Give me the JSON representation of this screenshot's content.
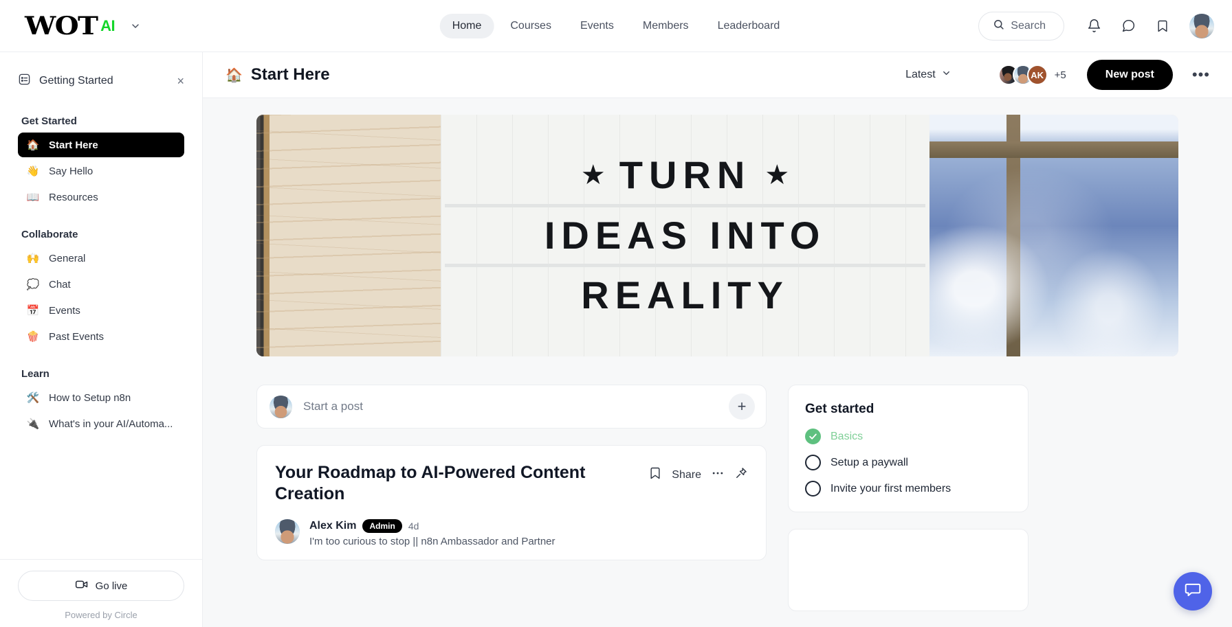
{
  "topbar": {
    "logo_primary": "WOT",
    "logo_accent": "AI",
    "logo_caret_icon": "chevron-down-icon",
    "nav": [
      {
        "label": "Home",
        "active": true
      },
      {
        "label": "Courses",
        "active": false
      },
      {
        "label": "Events",
        "active": false
      },
      {
        "label": "Members",
        "active": false
      },
      {
        "label": "Leaderboard",
        "active": false
      }
    ],
    "search_label": "Search",
    "icons": [
      "bell-icon",
      "messages-icon",
      "bookmark-icon"
    ],
    "avatar_alt": "user-avatar"
  },
  "sidebar": {
    "getting_started_label": "Getting Started",
    "getting_started_close": "×",
    "groups": [
      {
        "title": "Get Started",
        "items": [
          {
            "emoji": "🏠",
            "label": "Start Here",
            "active": true
          },
          {
            "emoji": "👋",
            "label": "Say Hello",
            "active": false
          },
          {
            "emoji": "📖",
            "label": "Resources",
            "active": false
          }
        ]
      },
      {
        "title": "Collaborate",
        "items": [
          {
            "emoji": "🙌",
            "label": "General",
            "active": false
          },
          {
            "emoji": "💭",
            "label": "Chat",
            "active": false
          },
          {
            "emoji": "📅",
            "label": "Events",
            "active": false
          },
          {
            "emoji": "🍿",
            "label": "Past Events",
            "active": false
          }
        ]
      },
      {
        "title": "Learn",
        "items": [
          {
            "emoji": "🛠️",
            "label": "How to Setup n8n",
            "active": false
          },
          {
            "emoji": "🔌",
            "label": "What's in your AI/Automa...",
            "active": false
          }
        ]
      }
    ],
    "go_live_label": "Go live",
    "powered_by": "Powered by Circle"
  },
  "content_header": {
    "emoji": "🏠",
    "title": "Start Here",
    "sort_label": "Latest",
    "member_overflow": "+5",
    "new_post_label": "New post",
    "more_label": "•••"
  },
  "banner": {
    "line1_star_left": "★",
    "line1_text": "TURN",
    "line1_star_right": "★",
    "line2_text": "IDEAS INTO",
    "line3_text": "REALITY"
  },
  "composer": {
    "placeholder": "Start a post",
    "add_label": "+"
  },
  "post": {
    "title": "Your Roadmap to AI-Powered Content Creation",
    "share_label": "Share",
    "bookmark_icon": "bookmark-icon",
    "more_icon": "more-horizontal-icon",
    "pin_icon": "pin-icon",
    "author_name": "Alex Kim",
    "author_badge": "Admin",
    "timestamp": "4d",
    "author_bio": "I'm too curious to stop || n8n Ambassador and Partner"
  },
  "get_started_panel": {
    "title": "Get started",
    "tasks": [
      {
        "label": "Basics",
        "done": true
      },
      {
        "label": "Setup a paywall",
        "done": false
      },
      {
        "label": "Invite your first members",
        "done": false
      }
    ]
  },
  "chat_widget": {
    "icon": "chat-bubble-icon",
    "color": "#4f63e8"
  },
  "colors": {
    "accent_green": "#14d62a",
    "active_black": "#000000",
    "done_green": "#5ec07f",
    "fab_blue": "#4f63e8",
    "avatar_ak_bg": "#a0522d"
  }
}
